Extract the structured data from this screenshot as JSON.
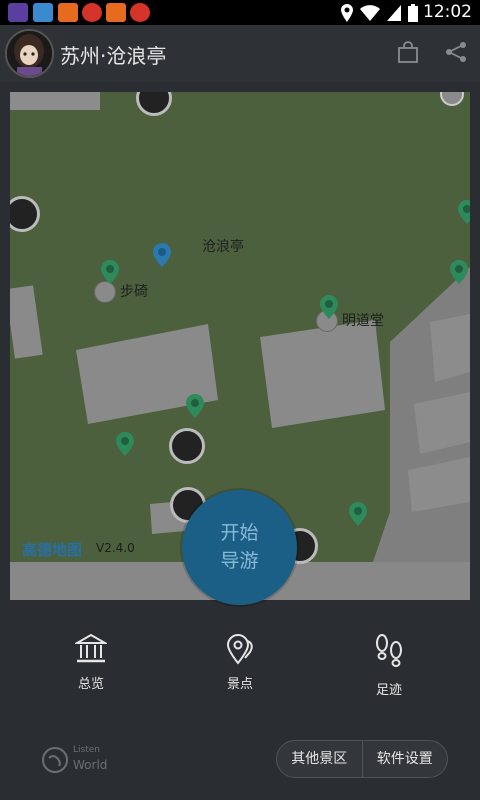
{
  "status_bar": {
    "time": "12:02",
    "notification_icons": [
      "cyberlink-icon",
      "cloud-app-icon",
      "taobao-icon",
      "target-app-icon",
      "taobao-icon",
      "target-app-icon"
    ]
  },
  "header": {
    "title": "苏州·沧浪亭"
  },
  "map": {
    "labels": {
      "main": "沧浪亭",
      "buchi": "步碕",
      "mingdaotang": "明道堂"
    },
    "provider_logo": "高德地图",
    "version": "V2.4.0"
  },
  "start_button": {
    "line1": "开始",
    "line2": "导游"
  },
  "bottom_nav": {
    "overview": "总览",
    "spots": "景点",
    "footprints": "足迹"
  },
  "brand": {
    "line1": "Listen",
    "line2": "World"
  },
  "actions": {
    "other_areas": "其他景区",
    "settings": "软件设置"
  },
  "colors": {
    "accent": "#1b5f86",
    "panel_bg": "#2a2d31",
    "map_green": "#4b5f3d",
    "pin_green": "#2e8a5a",
    "pin_blue": "#2a7ab0"
  }
}
